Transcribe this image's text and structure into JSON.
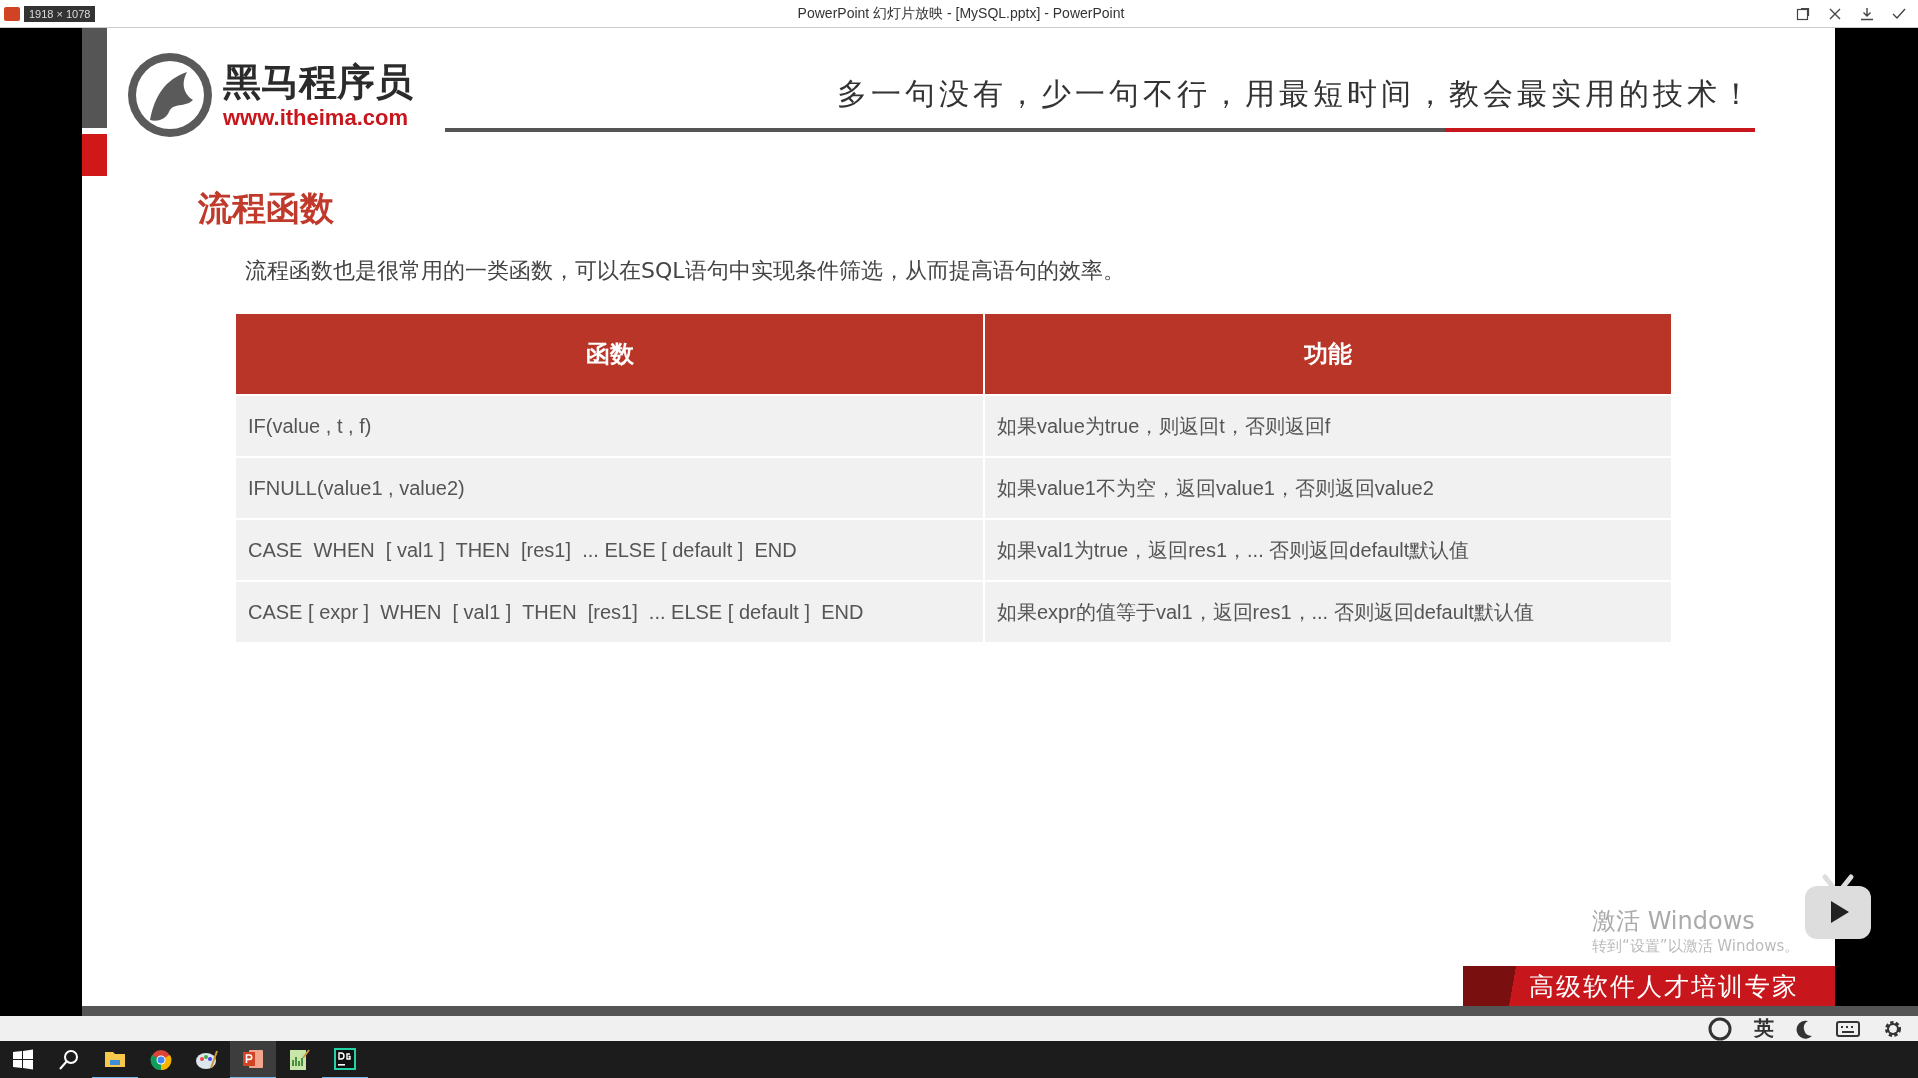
{
  "window": {
    "title": "PowerPoint 幻灯片放映 - [MySQL.pptx] - PowerPoint",
    "size_badge": "1918 × 1078"
  },
  "slide": {
    "logo": {
      "name": "黑马程序员",
      "url": "www.itheima.com"
    },
    "slogan": "多一句没有，少一句不行，用最短时间，教会最实用的技术！",
    "heading": "流程函数",
    "description": "流程函数也是很常用的一类函数，可以在SQL语句中实现条件筛选，从而提高语句的效率。",
    "table": {
      "columns": [
        "函数",
        "功能"
      ],
      "rows": [
        [
          "IF(value , t , f)",
          "如果value为true，则返回t，否则返回f"
        ],
        [
          "IFNULL(value1 , value2)",
          "如果value1不为空，返回value1，否则返回value2"
        ],
        [
          "CASE  WHEN  [ val1 ]  THEN  [res1]  ... ELSE [ default ]  END",
          "如果val1为true，返回res1，... 否则返回default默认值"
        ],
        [
          "CASE [ expr ]  WHEN  [ val1 ]  THEN  [res1]  ... ELSE [ default ]  END",
          "如果expr的值等于val1，返回res1，... 否则返回default默认值"
        ]
      ]
    },
    "footer_banner": "高级软件人才培训专家"
  },
  "activation": {
    "title": "激活 Windows",
    "hint": "转到“设置”以激活 Windows。"
  },
  "ime_bar": {
    "language": "英"
  },
  "taskbar": {
    "items": [
      {
        "kind": "start",
        "selected": false,
        "running": false
      },
      {
        "kind": "search",
        "selected": false,
        "running": false
      },
      {
        "kind": "folder",
        "selected": false,
        "running": true
      },
      {
        "kind": "chrome",
        "selected": false,
        "running": false
      },
      {
        "kind": "paint",
        "selected": false,
        "running": false
      },
      {
        "kind": "powerpoint",
        "selected": true,
        "running": true
      },
      {
        "kind": "notepad",
        "selected": false,
        "running": false
      },
      {
        "kind": "datagrip",
        "selected": false,
        "running": true
      }
    ]
  }
}
